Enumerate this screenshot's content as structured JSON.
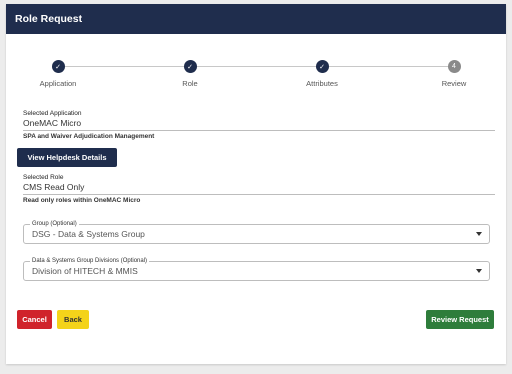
{
  "header": {
    "title": "Role Request"
  },
  "stepper": {
    "steps": [
      {
        "label": "Application",
        "status": "complete",
        "marker": "✓"
      },
      {
        "label": "Role",
        "status": "complete",
        "marker": "✓"
      },
      {
        "label": "Attributes",
        "status": "complete",
        "marker": "✓"
      },
      {
        "label": "Review",
        "status": "pending",
        "marker": "4"
      }
    ]
  },
  "application": {
    "label": "Selected Application",
    "value": "OneMAC Micro",
    "description": "SPA and Waiver Adjudication Management"
  },
  "helpdesk_button": {
    "label": "View Helpdesk Details"
  },
  "role": {
    "label": "Selected Role",
    "value": "CMS Read Only",
    "description": "Read only roles within OneMAC Micro"
  },
  "group_select": {
    "label": "Group (Optional)",
    "value": "DSG - Data & Systems Group"
  },
  "division_select": {
    "label": "Data & Systems Group Divisions (Optional)",
    "value": "Division of HITECH & MMIS"
  },
  "actions": {
    "cancel_label": "Cancel",
    "back_label": "Back",
    "review_label": "Review Request"
  },
  "colors": {
    "header_bg": "#1f2d4d",
    "cancel": "#d0232b",
    "back": "#f4d31a",
    "review": "#2e7d3b"
  }
}
